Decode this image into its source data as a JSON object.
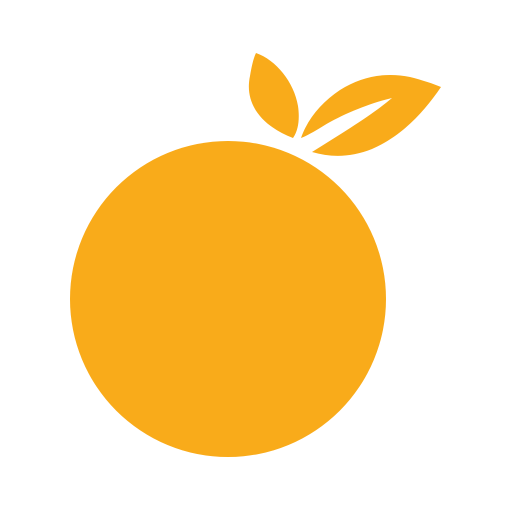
{
  "icon": {
    "name": "orange-fruit-icon",
    "color": "#F9AB1A",
    "background": "#FFFFFF"
  }
}
